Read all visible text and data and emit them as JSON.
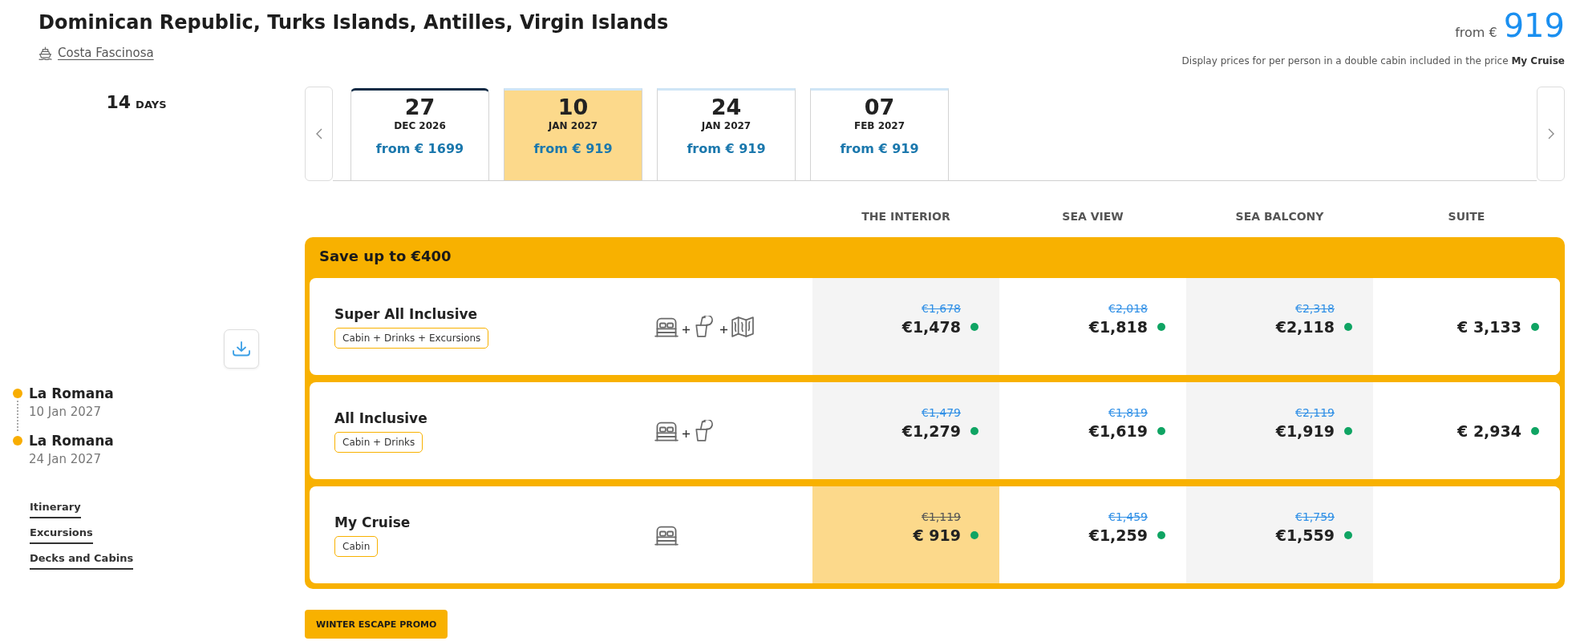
{
  "header": {
    "title": "Dominican Republic, Turks Islands, Antilles, Virgin Islands",
    "ship": "Costa Fascinosa",
    "from_label": "from €",
    "from_price": "919",
    "note": "Display prices for per person in a double cabin included in the price **My Cruise**"
  },
  "duration": {
    "number": "14",
    "unit": "DAYS"
  },
  "route": [
    {
      "port": "La Romana",
      "date": "10 Jan 2027"
    },
    {
      "port": "La Romana",
      "date": "24 Jan 2027"
    }
  ],
  "links": [
    "Itinerary",
    "Excursions",
    "Decks and Cabins"
  ],
  "dates": [
    {
      "day": "27",
      "month": "DEC 2026",
      "price": "from € 1699",
      "selected": false,
      "focused": true
    },
    {
      "day": "10",
      "month": "JAN 2027",
      "price": "from € 919",
      "selected": true,
      "focused": false
    },
    {
      "day": "24",
      "month": "JAN 2027",
      "price": "from € 919",
      "selected": false,
      "focused": false
    },
    {
      "day": "07",
      "month": "FEB 2027",
      "price": "from € 919",
      "selected": false,
      "focused": false
    }
  ],
  "cabin_types": [
    "THE INTERIOR",
    "SEA VIEW",
    "SEA BALCONY",
    "SUITE"
  ],
  "offer": {
    "banner": "Save up to €400",
    "packages": [
      {
        "name": "Super All Inclusive",
        "tag": "Cabin + Drinks + Excursions",
        "inclusions": [
          {
            "kind": "cabin"
          },
          {
            "kind": "drinks"
          },
          {
            "kind": "excursions"
          }
        ],
        "prices": [
          {
            "old": "€1,678",
            "price": "€1,478",
            "selected": false,
            "available": true
          },
          {
            "old": "€2,018",
            "price": "€1,818",
            "selected": false,
            "available": true
          },
          {
            "old": "€2,318",
            "price": "€2,118",
            "selected": false,
            "available": true
          },
          {
            "price": "€ 3,133",
            "selected": false,
            "available": true
          }
        ]
      },
      {
        "name": "All Inclusive",
        "tag": "Cabin + Drinks",
        "inclusions": [
          {
            "kind": "cabin"
          },
          {
            "kind": "drinks"
          }
        ],
        "prices": [
          {
            "old": "€1,479",
            "price": "€1,279",
            "selected": false,
            "available": true
          },
          {
            "old": "€1,819",
            "price": "€1,619",
            "selected": false,
            "available": true
          },
          {
            "old": "€2,119",
            "price": "€1,919",
            "selected": false,
            "available": true
          },
          {
            "price": "€ 2,934",
            "selected": false,
            "available": true
          }
        ]
      },
      {
        "name": "My Cruise",
        "tag": "Cabin",
        "inclusions": [
          {
            "kind": "cabin"
          }
        ],
        "prices": [
          {
            "old": "€1,119",
            "price": "€ 919",
            "selected": true,
            "available": true
          },
          {
            "old": "€1,459",
            "price": "€1,259",
            "selected": false,
            "available": true
          },
          {
            "old": "€1,759",
            "price": "€1,559",
            "selected": false,
            "available": true
          }
        ]
      }
    ]
  },
  "promo_button": "WINTER ESCAPE PROMO"
}
